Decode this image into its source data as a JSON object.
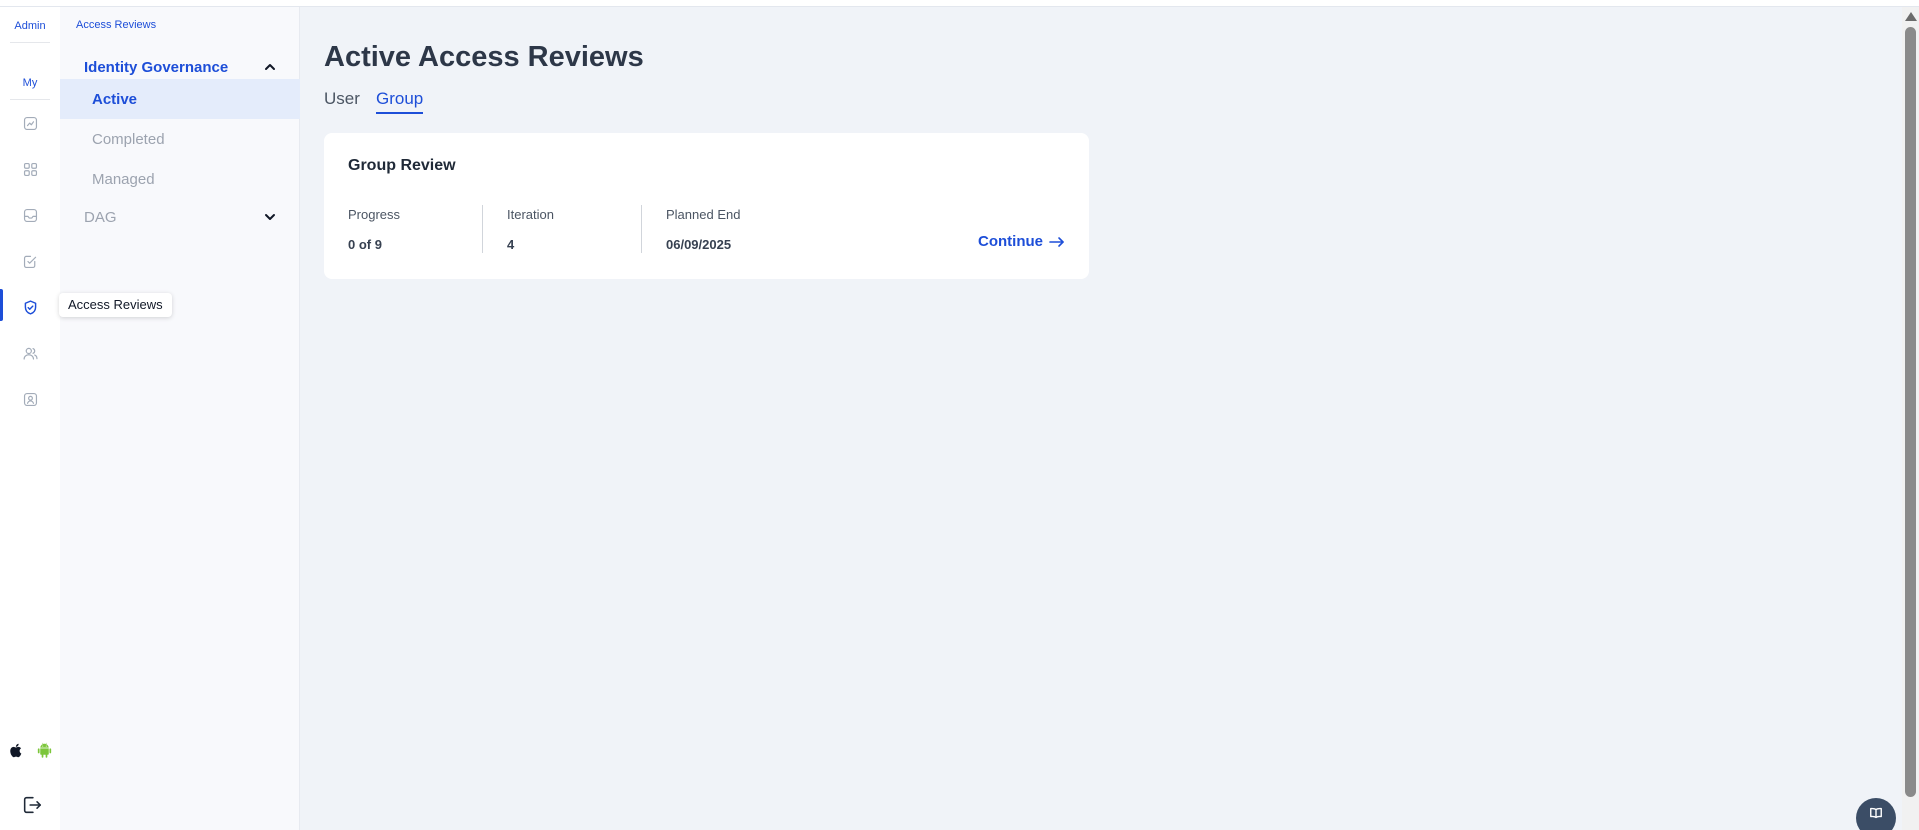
{
  "rail": {
    "admin_label": "Admin",
    "my_label": "My",
    "icons": [
      "chart-icon",
      "apps-grid-icon",
      "inbox-icon",
      "task-icon",
      "shield-check-icon",
      "users-icon",
      "badge-icon"
    ],
    "active_icon": "shield-check-icon",
    "tooltip": "Access Reviews",
    "platforms": [
      "apple-icon",
      "android-icon"
    ],
    "logout_icon": "logout-icon",
    "colors": {
      "accent": "#1d4ed8",
      "android": "#7cc63a"
    }
  },
  "subnav": {
    "breadcrumb": "Access Reviews",
    "section_identity": "Identity Governance",
    "items": [
      "Active",
      "Completed",
      "Managed"
    ],
    "active_item": "Active",
    "section_dag": "DAG"
  },
  "main": {
    "title": "Active Access Reviews",
    "tabs": [
      "User",
      "Group"
    ],
    "active_tab": "Group",
    "card": {
      "title": "Group Review",
      "fields": [
        {
          "label": "Progress",
          "value": "0 of 9"
        },
        {
          "label": "Iteration",
          "value": "4"
        },
        {
          "label": "Planned End",
          "value": "06/09/2025"
        }
      ],
      "action": "Continue"
    }
  },
  "help": {
    "icon": "book-icon"
  }
}
